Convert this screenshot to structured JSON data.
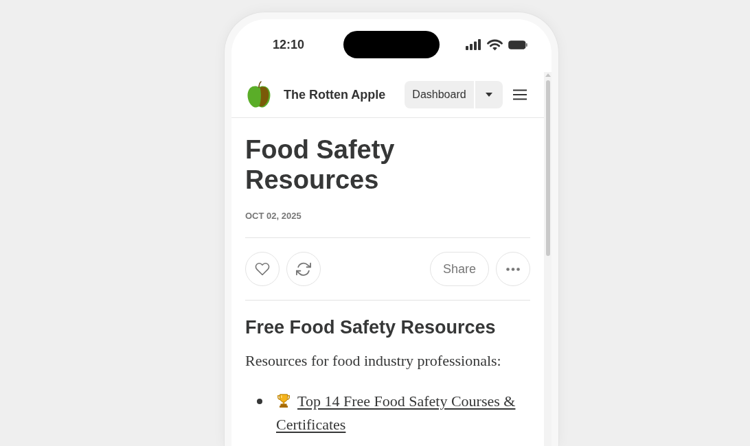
{
  "status_bar": {
    "time": "12:10"
  },
  "header": {
    "site_name": "The Rotten Apple",
    "dashboard_button": "Dashboard"
  },
  "post": {
    "title": "Food Safety Resources",
    "date": "OCT 02, 2025",
    "actions": [
      {
        "kind": "like"
      },
      {
        "kind": "repost"
      },
      {
        "kind": "share",
        "label": "Share"
      },
      {
        "kind": "more"
      }
    ]
  },
  "body": {
    "heading": "Free Food Safety Resources",
    "intro": "Resources for food industry professionals:",
    "list": [
      {
        "link": "Top 14 Free Food Safety Courses & Certificates"
      }
    ]
  }
}
